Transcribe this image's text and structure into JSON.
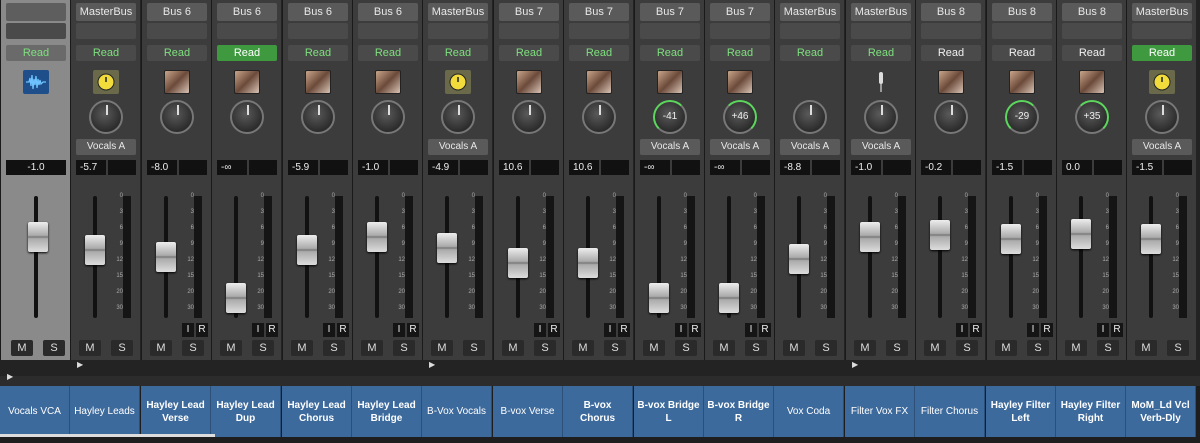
{
  "strips": [
    {
      "name": "Vocals VCA",
      "output": "",
      "read": "Read",
      "readState": "normal",
      "icon": "waveform-icon",
      "send": "",
      "vol": "-1.0",
      "bold": false,
      "knob": "",
      "fader": 0.72,
      "hasIR": false
    },
    {
      "name": "Hayley Leads",
      "output": "MasterBus",
      "read": "Read",
      "readState": "normal",
      "icon": "yellow-clock-icon",
      "send": "Vocals A",
      "vol": "-5.7",
      "bold": false,
      "knob": "",
      "fader": 0.58,
      "hasIR": false
    },
    {
      "name": "Hayley Lead Verse",
      "output": "Bus 6",
      "read": "Read",
      "readState": "normal",
      "icon": "photo-thumb-icon",
      "send": "",
      "vol": "-8.0",
      "bold": true,
      "knob": "",
      "fader": 0.5,
      "hasIR": true
    },
    {
      "name": "Hayley Lead Dup",
      "output": "Bus 6",
      "read": "Read",
      "readState": "on",
      "icon": "photo-thumb-icon",
      "send": "",
      "vol": "-∞",
      "bold": true,
      "knob": "",
      "fader": 0.05,
      "hasIR": true
    },
    {
      "name": "Hayley Lead Chorus",
      "output": "Bus 6",
      "read": "Read",
      "readState": "normal",
      "icon": "photo-thumb-icon",
      "send": "",
      "vol": "-5.9",
      "bold": true,
      "knob": "",
      "fader": 0.58,
      "hasIR": true
    },
    {
      "name": "Hayley Lead Bridge",
      "output": "Bus 6",
      "read": "Read",
      "readState": "normal",
      "icon": "photo-thumb-icon",
      "send": "",
      "vol": "-1.0",
      "bold": true,
      "knob": "",
      "fader": 0.72,
      "hasIR": true
    },
    {
      "name": "B-Vox Vocals",
      "output": "MasterBus",
      "read": "Read",
      "readState": "normal",
      "icon": "yellow-clock-icon",
      "send": "Vocals A",
      "vol": "-4.9",
      "bold": false,
      "knob": "",
      "fader": 0.6,
      "hasIR": false
    },
    {
      "name": "B-vox Verse",
      "output": "Bus 7",
      "read": "Read",
      "readState": "normal",
      "icon": "photo-thumb-icon",
      "send": "",
      "vol": "10.6",
      "bold": false,
      "knob": "",
      "fader": 0.44,
      "hasIR": true
    },
    {
      "name": "B-vox Chorus",
      "output": "Bus 7",
      "read": "Read",
      "readState": "normal",
      "icon": "photo-thumb-icon",
      "send": "",
      "vol": "10.6",
      "bold": true,
      "knob": "",
      "fader": 0.44,
      "hasIR": true
    },
    {
      "name": "B-vox Bridge L",
      "output": "Bus 7",
      "read": "Read",
      "readState": "normal",
      "icon": "photo-thumb-icon",
      "send": "Vocals A",
      "vol": "-∞",
      "bold": true,
      "knob": "-41",
      "fader": 0.05,
      "hasIR": true
    },
    {
      "name": "B-vox Bridge R",
      "output": "Bus 7",
      "read": "Read",
      "readState": "normal",
      "icon": "photo-thumb-icon",
      "send": "Vocals A",
      "vol": "-∞",
      "bold": true,
      "knob": "+46",
      "fader": 0.05,
      "hasIR": true
    },
    {
      "name": "Vox Coda",
      "output": "MasterBus",
      "read": "Read",
      "readState": "normal",
      "icon": "",
      "send": "Vocals A",
      "vol": "-8.8",
      "bold": false,
      "knob": "",
      "fader": 0.48,
      "hasIR": false
    },
    {
      "name": "Filter Vox FX",
      "output": "MasterBus",
      "read": "Read",
      "readState": "normal",
      "icon": "mic-icon",
      "send": "Vocals A",
      "vol": "-1.0",
      "bold": false,
      "knob": "",
      "fader": 0.72,
      "hasIR": false
    },
    {
      "name": "Filter Chorus",
      "output": "Bus 8",
      "read": "Read",
      "readState": "white",
      "icon": "photo-thumb-icon",
      "send": "",
      "vol": "-0.2",
      "bold": false,
      "knob": "",
      "fader": 0.74,
      "hasIR": true
    },
    {
      "name": "Hayley Filter Left",
      "output": "Bus 8",
      "read": "Read",
      "readState": "white",
      "icon": "photo-thumb-icon",
      "send": "",
      "vol": "-1.5",
      "bold": true,
      "knob": "-29",
      "fader": 0.7,
      "hasIR": true
    },
    {
      "name": "Hayley Filter Right",
      "output": "Bus 8",
      "read": "Read",
      "readState": "white",
      "icon": "photo-thumb-icon",
      "send": "",
      "vol": "0.0",
      "bold": true,
      "knob": "+35",
      "fader": 0.75,
      "hasIR": true
    },
    {
      "name": "MoM_Ld Vcl Verb-Dly",
      "output": "MasterBus",
      "read": "Read",
      "readState": "on",
      "icon": "yellow-clock-icon",
      "send": "Vocals A",
      "vol": "-1.5",
      "bold": true,
      "knob": "",
      "fader": 0.7,
      "hasIR": false
    }
  ],
  "labels": {
    "mute": "M",
    "solo": "S",
    "input": "I",
    "record": "R"
  },
  "scale": [
    "0",
    "3",
    "6",
    "9",
    "12",
    "15",
    "20",
    "30"
  ],
  "colors": {
    "accent": "#3d6a9c",
    "green": "#5cd65c",
    "readOn": "#3f9a3f"
  }
}
